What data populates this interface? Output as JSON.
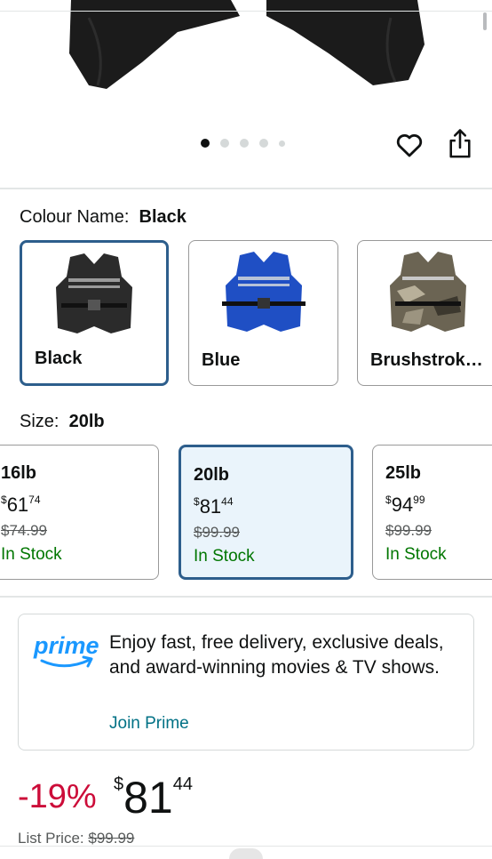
{
  "gallery": {
    "dots": 5,
    "active_dot": 1,
    "icons": [
      "heart-icon",
      "share-icon"
    ]
  },
  "colour": {
    "label": "Colour Name:",
    "value": "Black",
    "options": [
      {
        "name": "Black",
        "color": "#2b2b2b",
        "selected": true
      },
      {
        "name": "Blue",
        "color": "#1f4fc4",
        "selected": false
      },
      {
        "name": "Brushstrok…",
        "color": "#6b6453",
        "selected": false
      }
    ]
  },
  "size": {
    "label": "Size:",
    "value": "20lb",
    "options": [
      {
        "weight": "16lb",
        "cur": "$",
        "dollars": "61",
        "cents": "74",
        "list": "$74.99",
        "stock": "In Stock",
        "selected": false
      },
      {
        "weight": "20lb",
        "cur": "$",
        "dollars": "81",
        "cents": "44",
        "list": "$99.99",
        "stock": "In Stock",
        "selected": true
      },
      {
        "weight": "25lb",
        "cur": "$",
        "dollars": "94",
        "cents": "99",
        "list": "$99.99",
        "stock": "In Stock",
        "selected": false
      }
    ]
  },
  "prime": {
    "logo": "prime",
    "text": "Enjoy fast, free delivery, exclusive deals, and award-winning movies & TV shows.",
    "join": "Join Prime"
  },
  "price": {
    "discount": "-19%",
    "currency": "$",
    "dollars": "81",
    "cents": "44",
    "list_label": "List Price:",
    "list_value": "$99.99"
  },
  "colors": {
    "accent_border": "#2d5e8c",
    "selected_bg": "#eaf4fb",
    "in_stock": "#007600",
    "discount": "#cc0c39",
    "link": "#007185",
    "prime_blue": "#1a98ff"
  }
}
